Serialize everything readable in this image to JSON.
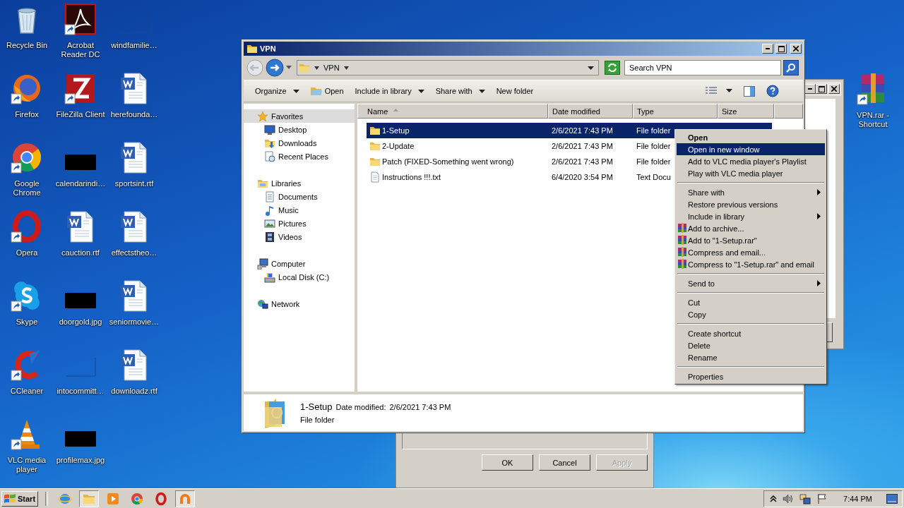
{
  "desktop": {
    "icons": [
      {
        "label": "Recycle Bin",
        "kind": "bin",
        "shortcut": false
      },
      {
        "label": "Firefox",
        "kind": "fox",
        "shortcut": true
      },
      {
        "label": "Google Chrome",
        "kind": "chrome",
        "shortcut": true
      },
      {
        "label": "Opera",
        "kind": "opera",
        "shortcut": true
      },
      {
        "label": "Skype",
        "kind": "skype",
        "shortcut": true
      },
      {
        "label": "CCleaner",
        "kind": "cleaner",
        "shortcut": true
      },
      {
        "label": "VLC media player",
        "kind": "cone",
        "shortcut": true
      },
      {
        "label": "Acrobat Reader DC",
        "kind": "pdf",
        "shortcut": true
      },
      {
        "label": "FileZilla Client",
        "kind": "ftp",
        "shortcut": true
      },
      {
        "label": "calendarindi…",
        "kind": "thumb",
        "shortcut": false
      },
      {
        "label": "cauction.rtf",
        "kind": "doc",
        "shortcut": false
      },
      {
        "label": "doorgold.jpg",
        "kind": "thumb",
        "shortcut": false
      },
      {
        "label": "intocommitt…",
        "kind": "blank",
        "shortcut": false
      },
      {
        "label": "profilemax.jpg",
        "kind": "thumb",
        "shortcut": false
      },
      {
        "label": "windfamilie…",
        "kind": "blank",
        "shortcut": false
      },
      {
        "label": "herefounda…",
        "kind": "doc",
        "shortcut": false
      },
      {
        "label": "sportsint.rtf",
        "kind": "doc",
        "shortcut": false
      },
      {
        "label": "effectstheo…",
        "kind": "doc",
        "shortcut": false
      },
      {
        "label": "seniormovie…",
        "kind": "doc",
        "shortcut": false
      },
      {
        "label": "downloadz.rtf",
        "kind": "doc",
        "shortcut": false
      }
    ],
    "icons_right": [
      {
        "label": "VPN.rar - Shortcut",
        "kind": "rar",
        "shortcut": true
      }
    ]
  },
  "explorer": {
    "title": "VPN",
    "breadcrumb": "VPN",
    "search": {
      "placeholder": "Search VPN"
    },
    "commands": [
      {
        "label": "Organize",
        "kind": "menu"
      },
      {
        "label": "Open",
        "kind": "icon"
      },
      {
        "label": "Include in library",
        "kind": "menu"
      },
      {
        "label": "Share with",
        "kind": "menu"
      },
      {
        "label": "New folder",
        "kind": "plain"
      }
    ],
    "nav": [
      {
        "label": "Favorites",
        "kind": "star",
        "selected": true,
        "children": [
          {
            "label": "Desktop",
            "kind": "monitor",
            "selected": false
          },
          {
            "label": "Downloads",
            "kind": "download",
            "selected": false
          },
          {
            "label": "Recent Places",
            "kind": "recent",
            "selected": false
          }
        ]
      },
      {
        "label": "Libraries",
        "kind": "library",
        "selected": false,
        "children": [
          {
            "label": "Documents",
            "kind": "docs",
            "selected": false
          },
          {
            "label": "Music",
            "kind": "music",
            "selected": false
          },
          {
            "label": "Pictures",
            "kind": "pictures",
            "selected": false
          },
          {
            "label": "Videos",
            "kind": "videos",
            "selected": false
          }
        ]
      },
      {
        "label": "Computer",
        "kind": "computer",
        "selected": false,
        "children": [
          {
            "label": "Local Disk (C:)",
            "kind": "disk",
            "selected": false
          }
        ]
      },
      {
        "label": "Network",
        "kind": "network",
        "selected": false
      }
    ],
    "columns": [
      {
        "label": "Name",
        "sorted": true
      },
      {
        "label": "Date modified",
        "sorted": false
      },
      {
        "label": "Type",
        "sorted": false
      },
      {
        "label": "Size",
        "sorted": false
      }
    ],
    "files": [
      {
        "name": "1-Setup",
        "date": "2/6/2021 7:43 PM",
        "type": "File folder",
        "kind": "folder",
        "selected": true
      },
      {
        "name": "2-Update",
        "date": "2/6/2021 7:43 PM",
        "type": "File folder",
        "kind": "folder",
        "selected": false
      },
      {
        "name": "Patch (FIXED-Something went wrong)",
        "date": "2/6/2021 7:43 PM",
        "type": "File folder",
        "kind": "folder",
        "selected": false
      },
      {
        "name": "Instructions !!!.txt",
        "date": "6/4/2020 3:54 PM",
        "type": "Text Docu",
        "kind": "text",
        "selected": false
      }
    ],
    "details": {
      "name": "1-Setup",
      "date_label": "Date modified:",
      "date": "2/6/2021 7:43 PM",
      "type": "File folder"
    }
  },
  "context_menu": [
    {
      "label": "Open",
      "kind": "default",
      "selected": false,
      "submenu": false
    },
    {
      "label": "Open in new window",
      "kind": "plain",
      "selected": true,
      "submenu": false
    },
    {
      "label": "Add to VLC media player's Playlist",
      "kind": "plain",
      "selected": false,
      "submenu": false
    },
    {
      "label": "Play with VLC media player",
      "kind": "plain",
      "selected": false,
      "submenu": false
    },
    {
      "kind": "separator"
    },
    {
      "label": "Share with",
      "kind": "plain",
      "selected": false,
      "submenu": true
    },
    {
      "label": "Restore previous versions",
      "kind": "plain",
      "selected": false,
      "submenu": false
    },
    {
      "label": "Include in library",
      "kind": "plain",
      "selected": false,
      "submenu": true
    },
    {
      "label": "Add to archive...",
      "kind": "archive",
      "selected": false,
      "submenu": false
    },
    {
      "label": "Add to \"1-Setup.rar\"",
      "kind": "archive",
      "selected": false,
      "submenu": false
    },
    {
      "label": "Compress and email...",
      "kind": "archive",
      "selected": false,
      "submenu": false
    },
    {
      "label": "Compress to \"1-Setup.rar\" and email",
      "kind": "archive",
      "selected": false,
      "submenu": false
    },
    {
      "kind": "separator"
    },
    {
      "label": "Send to",
      "kind": "plain",
      "selected": false,
      "submenu": true
    },
    {
      "kind": "separator"
    },
    {
      "label": "Cut",
      "kind": "plain",
      "selected": false,
      "submenu": false
    },
    {
      "label": "Copy",
      "kind": "plain",
      "selected": false,
      "submenu": false
    },
    {
      "kind": "separator"
    },
    {
      "label": "Create shortcut",
      "kind": "plain",
      "selected": false,
      "submenu": false
    },
    {
      "label": "Delete",
      "kind": "plain",
      "selected": false,
      "submenu": false
    },
    {
      "label": "Rename",
      "kind": "plain",
      "selected": false,
      "submenu": false
    },
    {
      "kind": "separator"
    },
    {
      "label": "Properties",
      "kind": "plain",
      "selected": false,
      "submenu": false
    }
  ],
  "dialog": {
    "buttons": [
      {
        "label": "OK",
        "disabled": false
      },
      {
        "label": "Cancel",
        "disabled": false
      },
      {
        "label": "Apply",
        "disabled": true
      }
    ]
  },
  "taskbar": {
    "start": "Start",
    "apps": [
      {
        "kind": "ie",
        "active": false
      },
      {
        "kind": "folder",
        "active": true
      },
      {
        "kind": "media",
        "active": false
      },
      {
        "kind": "chrome",
        "active": false
      },
      {
        "kind": "opera",
        "active": false
      },
      {
        "kind": "arch",
        "active": true
      }
    ],
    "clock": "7:44 PM"
  }
}
